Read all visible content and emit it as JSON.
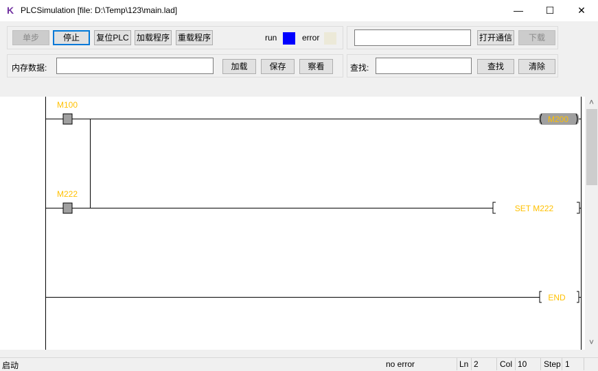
{
  "window": {
    "title": "PLCSimulation [file: D:\\Temp\\123\\main.lad]",
    "app_icon": "K",
    "minimize": "—",
    "maximize": "☐",
    "close": "✕"
  },
  "toolbar": {
    "step": "单步",
    "stop": "停止",
    "reset": "复位PLC",
    "load_program": "加载程序",
    "reload_program": "重载程序",
    "run_label": "run",
    "error_label": "error",
    "run_color": "#0000ff",
    "error_color": "#ece9d8",
    "comm_value": "",
    "open_comm": "打开通信",
    "download": "下载",
    "memory_label": "内存数据:",
    "memory_value": "",
    "load": "加载",
    "save": "保存",
    "view": "察看",
    "find_label": "查找:",
    "find_value": "",
    "find": "查找",
    "clear": "清除"
  },
  "ladder": {
    "contacts": [
      "M100",
      "M222"
    ],
    "coil": "M200",
    "set": "SET M222",
    "end": "END",
    "text_color": "#ffc000",
    "active_fill": "#a0a0a0"
  },
  "scrollbar": {
    "up": "˄",
    "down": "˅"
  },
  "status": {
    "state": "启动",
    "error": "no error",
    "ln_label": "Ln",
    "ln": "2",
    "col_label": "Col",
    "col": "10",
    "step_label": "Step",
    "step": "1"
  }
}
